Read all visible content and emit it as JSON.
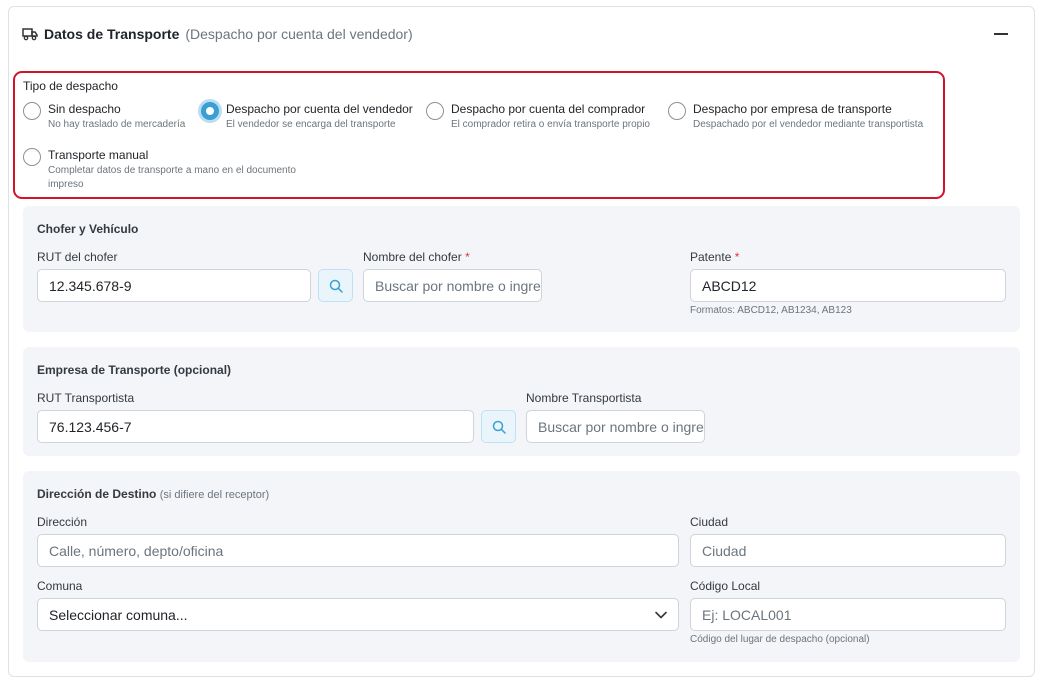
{
  "header": {
    "title": "Datos de Transporte",
    "subtitle": "(Despacho por cuenta del vendedor)"
  },
  "dispatch_type": {
    "label": "Tipo de despacho",
    "options": [
      {
        "label": "Sin despacho",
        "desc": "No hay traslado de mercadería",
        "checked": false
      },
      {
        "label": "Despacho por cuenta del vendedor",
        "desc": "El vendedor se encarga del transporte",
        "checked": true
      },
      {
        "label": "Despacho por cuenta del comprador",
        "desc": "El comprador retira o envía transporte propio",
        "checked": false
      },
      {
        "label": "Despacho por empresa de transporte",
        "desc": "Despachado por el vendedor mediante transportista",
        "checked": false
      },
      {
        "label": "Transporte manual",
        "desc": "Completar datos de transporte a mano en el documento impreso",
        "checked": false
      }
    ]
  },
  "driver": {
    "title": "Chofer y Vehículo",
    "rut_label": "RUT del chofer",
    "rut_value": "12.345.678-9",
    "name_label": "Nombre del chofer",
    "name_placeholder": "Buscar por nombre o ingresar",
    "plate_label": "Patente",
    "plate_value": "ABCD12",
    "plate_hint": "Formatos: ABCD12, AB1234, AB123",
    "required_mark": "*"
  },
  "company": {
    "title": "Empresa de Transporte (opcional)",
    "rut_label": "RUT Transportista",
    "rut_value": "76.123.456-7",
    "name_label": "Nombre Transportista",
    "name_placeholder": "Buscar por nombre o ingresar"
  },
  "destination": {
    "title": "Dirección de Destino",
    "title_note": "(si difiere del receptor)",
    "address_label": "Dirección",
    "address_placeholder": "Calle, número, depto/oficina",
    "city_label": "Ciudad",
    "city_placeholder": "Ciudad",
    "comuna_label": "Comuna",
    "comuna_value": "Seleccionar comuna...",
    "local_label": "Código Local",
    "local_placeholder": "Ej: LOCAL001",
    "local_hint": "Código del lugar de despacho (opcional)"
  },
  "colors": {
    "accent": "#3b9fd3",
    "highlight_border": "#d3132c",
    "section_bg": "#f3f5f8",
    "required": "#dc3545"
  }
}
